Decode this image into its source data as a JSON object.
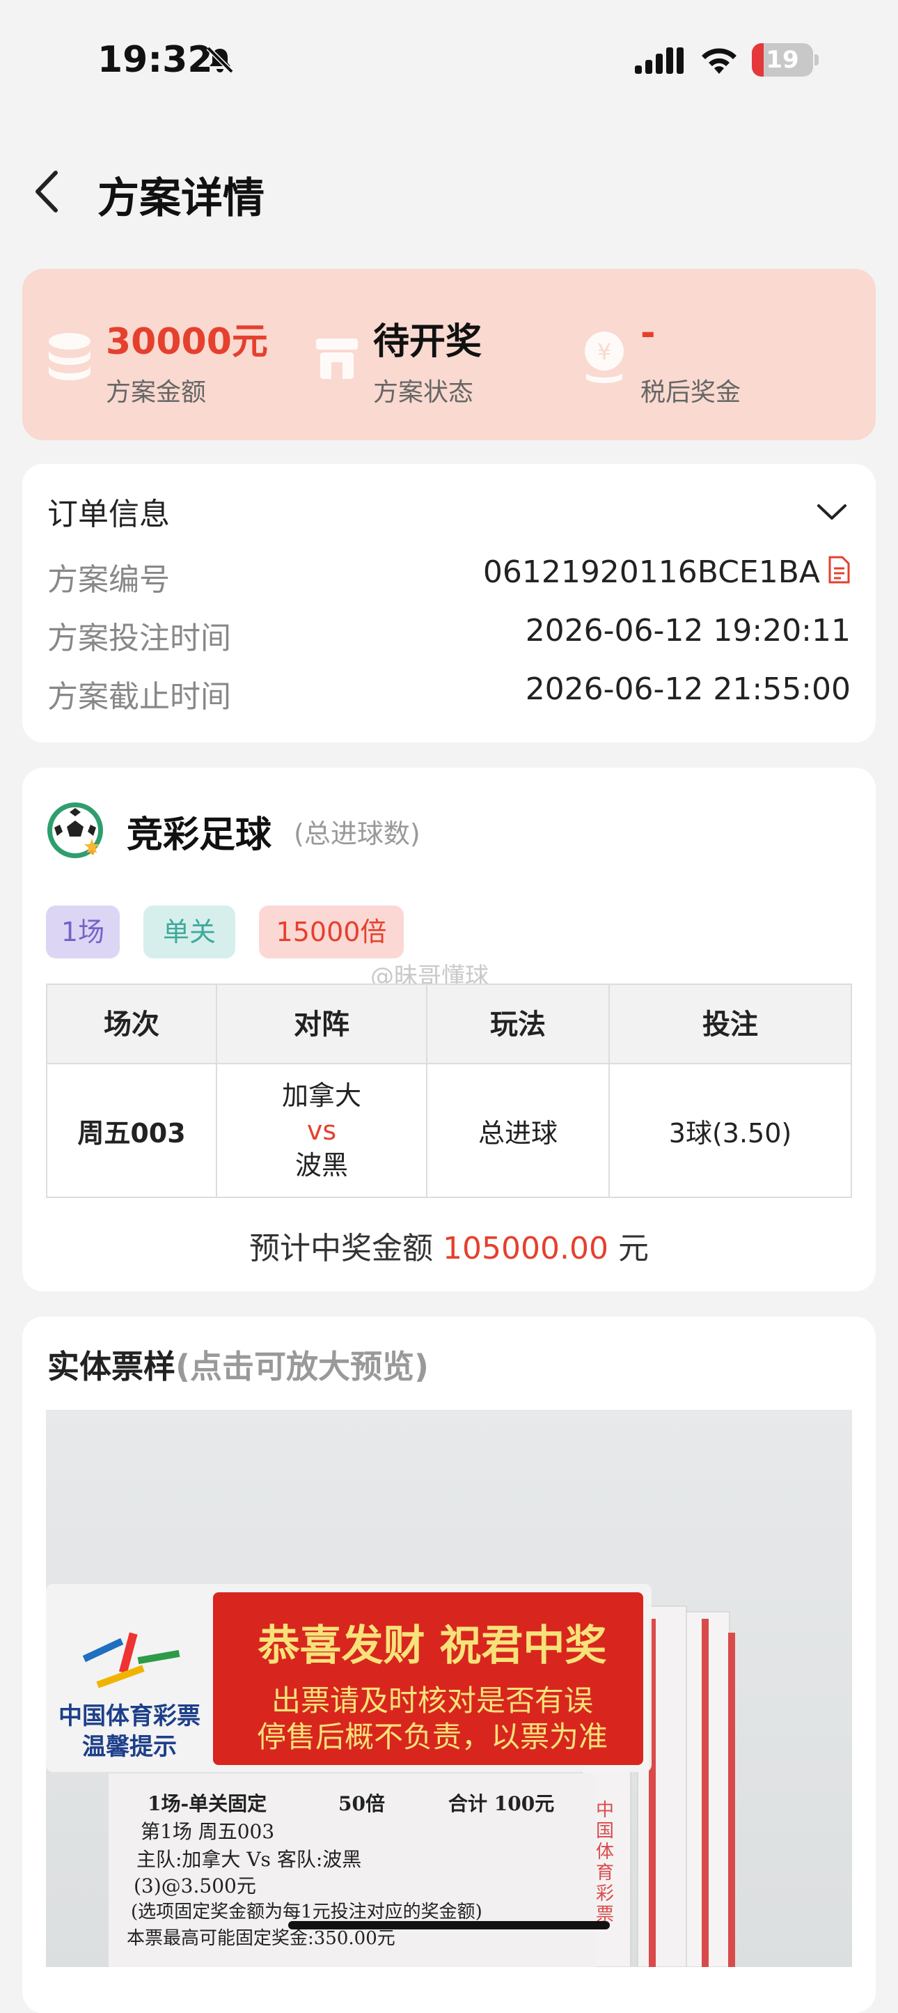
{
  "status_bar": {
    "time": "19:32",
    "battery": "19",
    "battery_level_percent": 19,
    "battery_color": "#e5383b"
  },
  "nav": {
    "title": "方案详情",
    "back_icon": "chevron-left-icon"
  },
  "summary": {
    "amount": {
      "value": "30000元",
      "label": "方案金额",
      "icon": "coins-icon",
      "color": "#e5402e"
    },
    "status": {
      "value": "待开奖",
      "label": "方案状态",
      "icon": "shop-icon",
      "color": "#111111"
    },
    "prize": {
      "value": "-",
      "label": "税后奖金",
      "icon": "yuan-money-icon",
      "color": "#e5402e"
    }
  },
  "order": {
    "title": "订单信息",
    "rows": [
      {
        "label": "方案编号",
        "value": "06121920116BCE1BA"
      },
      {
        "label": "方案投注时间",
        "value": "2026-06-12 19:20:11"
      },
      {
        "label": "方案截止时间",
        "value": "2026-06-12 21:55:00"
      }
    ]
  },
  "match": {
    "title": "竞彩足球",
    "subtitle": "(总进球数)",
    "tags": [
      {
        "text": "1场",
        "bg": "#dcd6f4",
        "color": "#7563c8"
      },
      {
        "text": "单关",
        "bg": "#d6efec",
        "color": "#3fa99c"
      },
      {
        "text": "15000倍",
        "bg": "#fbd8d3",
        "color": "#e5402e"
      }
    ],
    "watermark": "@昧哥懂球",
    "table": {
      "headers": [
        "场次",
        "对阵",
        "玩法",
        "投注"
      ],
      "row": {
        "session": "周五003",
        "home": "加拿大",
        "vs": "vs",
        "away": "波黑",
        "play": "总进球",
        "bet": "3球(3.50)"
      }
    },
    "prize_prefix": "预计中奖金额",
    "prize_amount": "105000.00",
    "prize_unit": "元"
  },
  "ticket": {
    "title": "实体票样",
    "subtitle": "(点击可放大预览)",
    "photo": {
      "sign_big": "恭喜发财 祝君中奖",
      "sign_line1": "出票请及时核对是否有误",
      "sign_line2": "停售后概不负责，以票为准",
      "sign_brand": "中国体育彩票",
      "sign_brand2": "温馨提示",
      "ticket_line1": "1场-单关固定",
      "ticket_mult": "50倍",
      "ticket_total": "合计 100元",
      "ticket_line2": "第1场  周五003",
      "ticket_line3": "主队:加拿大 Vs  客队:波黑",
      "ticket_line4": "(3)@3.500元",
      "ticket_line5": "(选项固定奖金额为每1元投注对应的奖金额)",
      "ticket_line6": "本票最高可能固定奖金:350.00元",
      "side_text": "中国体育彩票"
    }
  }
}
